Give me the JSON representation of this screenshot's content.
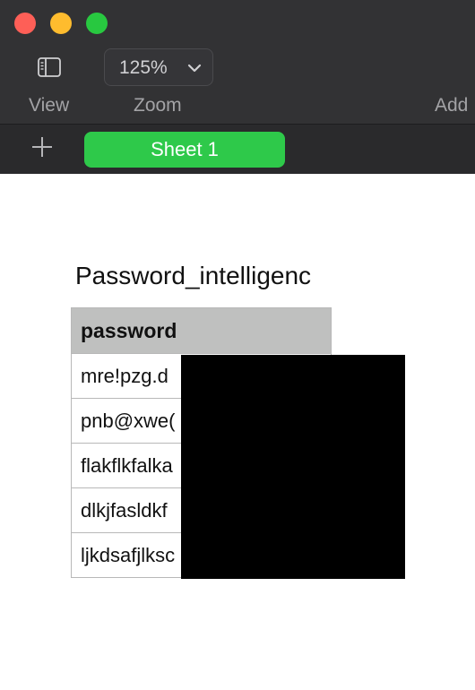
{
  "toolbar": {
    "view_label": "View",
    "zoom_value": "125%",
    "zoom_label": "Zoom",
    "add_label": "Add"
  },
  "tabs": {
    "active_sheet": "Sheet 1"
  },
  "sheet": {
    "table_title": "Password_intelligenc",
    "column_header": "password",
    "rows": [
      "mre!pzg.d",
      "pnb@xwe(",
      "flakflkfalka",
      "dlkjfasldkf",
      "ljkdsafjlksc"
    ]
  },
  "colors": {
    "titlebar": "#323234",
    "tab_active": "#2ec94a",
    "header_fill": "#bfc0bf"
  }
}
